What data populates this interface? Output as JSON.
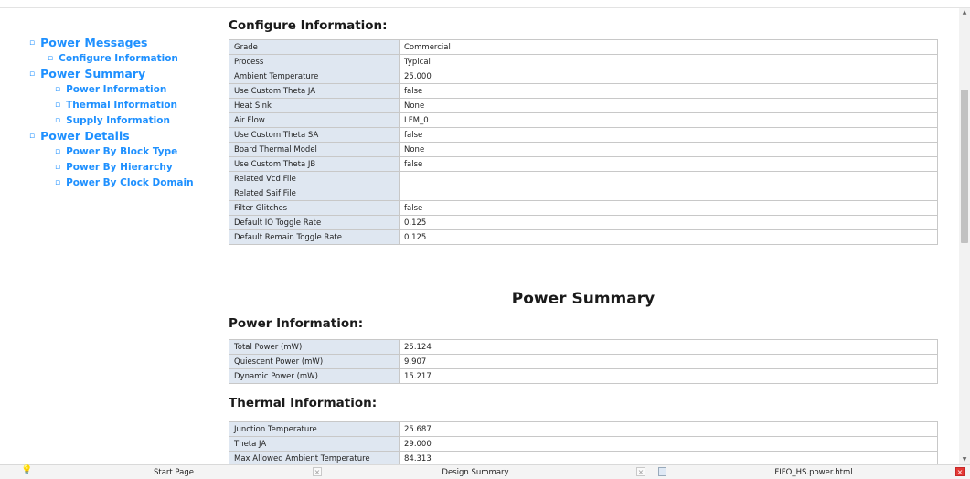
{
  "nav": {
    "power_messages": "Power Messages",
    "configure_information": "Configure Information",
    "power_summary": "Power Summary",
    "power_information": "Power Information",
    "thermal_information": "Thermal Information",
    "supply_information": "Supply Information",
    "power_details": "Power Details",
    "power_by_block_type": "Power By Block Type",
    "power_by_hierarchy": "Power By Hierarchy",
    "power_by_clock_domain": "Power By Clock Domain",
    "bullet": "▫"
  },
  "configure": {
    "title": "Configure Information:",
    "rows": [
      {
        "key": "Grade",
        "value": "Commercial"
      },
      {
        "key": "Process",
        "value": "Typical"
      },
      {
        "key": "Ambient Temperature",
        "value": "25.000"
      },
      {
        "key": "Use Custom Theta JA",
        "value": "false"
      },
      {
        "key": "Heat Sink",
        "value": "None"
      },
      {
        "key": "Air Flow",
        "value": "LFM_0"
      },
      {
        "key": "Use Custom Theta SA",
        "value": "false"
      },
      {
        "key": "Board Thermal Model",
        "value": "None"
      },
      {
        "key": "Use Custom Theta JB",
        "value": "false"
      },
      {
        "key": "Related Vcd File",
        "value": ""
      },
      {
        "key": "Related Saif File",
        "value": ""
      },
      {
        "key": "Filter Glitches",
        "value": "false"
      },
      {
        "key": "Default IO Toggle Rate",
        "value": "0.125"
      },
      {
        "key": "Default Remain Toggle Rate",
        "value": "0.125"
      }
    ]
  },
  "summary_title": "Power Summary",
  "power_info": {
    "title": "Power Information:",
    "rows": [
      {
        "key": "Total Power (mW)",
        "value": "25.124"
      },
      {
        "key": "Quiescent Power (mW)",
        "value": "9.907"
      },
      {
        "key": "Dynamic Power (mW)",
        "value": "15.217"
      }
    ]
  },
  "thermal_info": {
    "title": "Thermal Information:",
    "rows": [
      {
        "key": "Junction Temperature",
        "value": "25.687"
      },
      {
        "key": "Theta JA",
        "value": "29.000"
      },
      {
        "key": "Max Allowed Ambient Temperature",
        "value": "84.313"
      }
    ]
  },
  "tabs": {
    "start_page": "Start Page",
    "design_summary": "Design Summary",
    "file_tab": "FIFO_HS.power.html",
    "close_glyph": "×"
  },
  "icons": {
    "bulb": "💡",
    "scroll_up": "▲",
    "scroll_down": "▼"
  },
  "colors": {
    "link": "#1e90ff",
    "key_cell_bg": "#dfe7f1",
    "close_active": "#e53935"
  }
}
